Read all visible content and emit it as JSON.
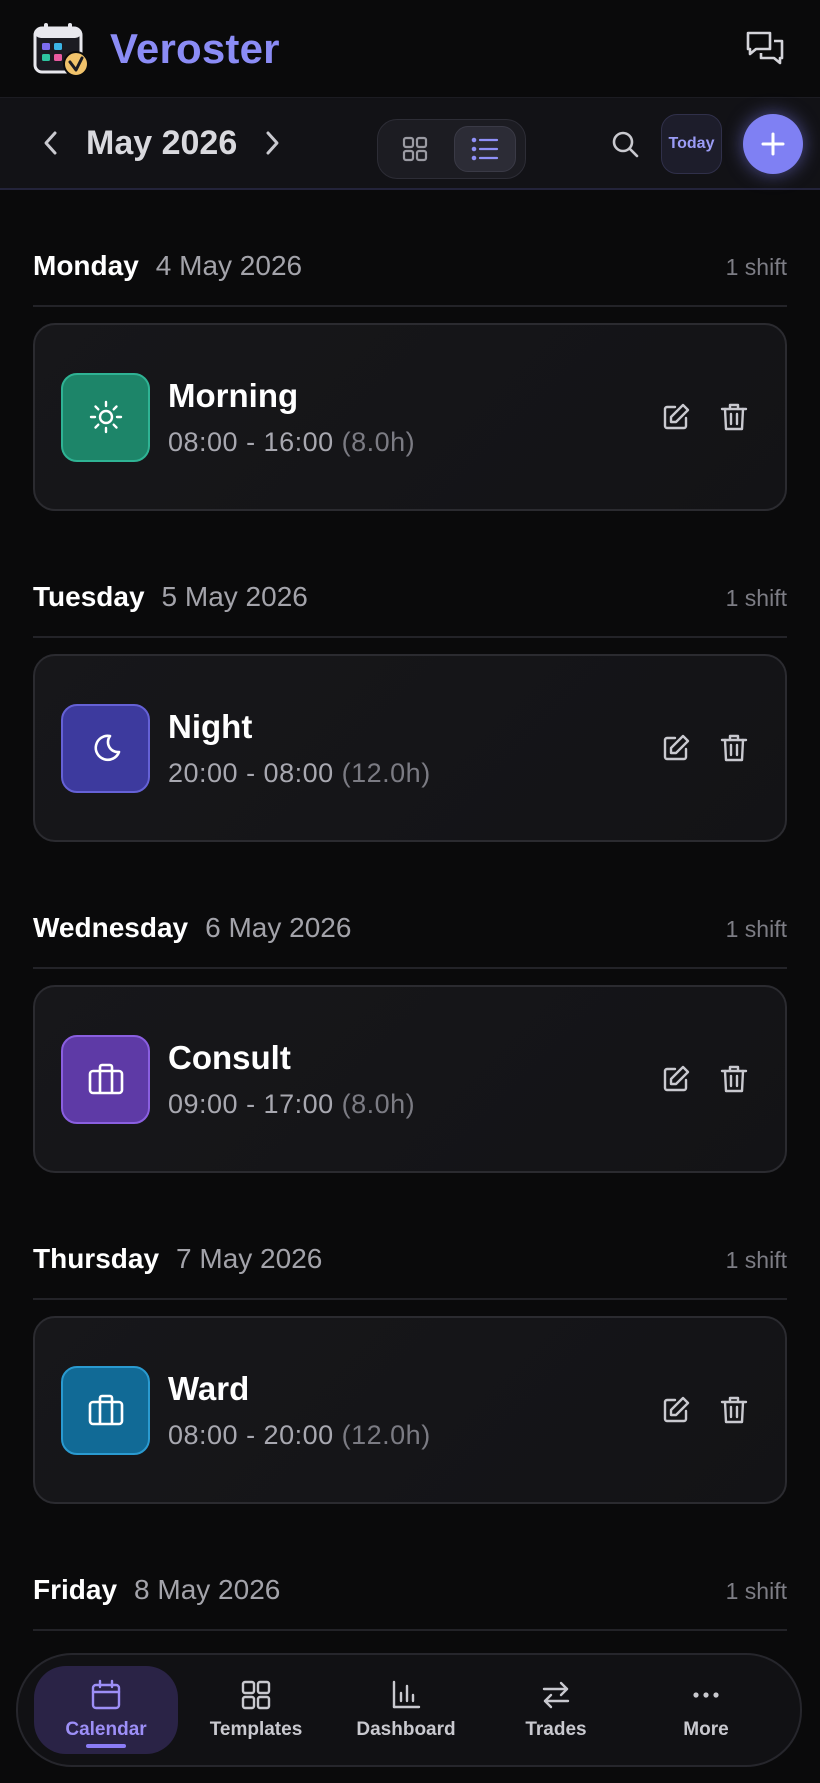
{
  "app": {
    "title": "Veroster"
  },
  "toolbar": {
    "month": "May 2026",
    "today_label": "Today"
  },
  "days": [
    {
      "weekday": "Monday",
      "date": "4 May 2026",
      "count": "1 shift",
      "shift": {
        "name": "Morning",
        "time": "08:00 - 16:00",
        "hours": "(8.0h)",
        "icon": "sun-icon",
        "color": "#1f8a70"
      }
    },
    {
      "weekday": "Tuesday",
      "date": "5 May 2026",
      "count": "1 shift",
      "shift": {
        "name": "Night",
        "time": "20:00 - 08:00",
        "hours": "(12.0h)",
        "icon": "moon-icon",
        "color": "#4a46b8"
      }
    },
    {
      "weekday": "Wednesday",
      "date": "6 May 2026",
      "count": "1 shift",
      "shift": {
        "name": "Consult",
        "time": "09:00 - 17:00",
        "hours": "(8.0h)",
        "icon": "briefcase-icon",
        "color": "#6b3fb5"
      }
    },
    {
      "weekday": "Thursday",
      "date": "7 May 2026",
      "count": "1 shift",
      "shift": {
        "name": "Ward",
        "time": "08:00 - 20:00",
        "hours": "(12.0h)",
        "icon": "briefcase-icon",
        "color": "#136f9e"
      }
    },
    {
      "weekday": "Friday",
      "date": "8 May 2026",
      "count": "1 shift"
    }
  ],
  "bottom_nav": [
    {
      "label": "Calendar",
      "icon": "calendar-icon",
      "active": true
    },
    {
      "label": "Templates",
      "icon": "grid-icon"
    },
    {
      "label": "Dashboard",
      "icon": "bar-chart-icon"
    },
    {
      "label": "Trades",
      "icon": "swap-icon"
    },
    {
      "label": "More",
      "icon": "more-icon"
    }
  ],
  "colors": {
    "accent": "#7f80f3",
    "title": "#8b8cf5",
    "background": "#0a0a0b",
    "card": "#151518"
  }
}
